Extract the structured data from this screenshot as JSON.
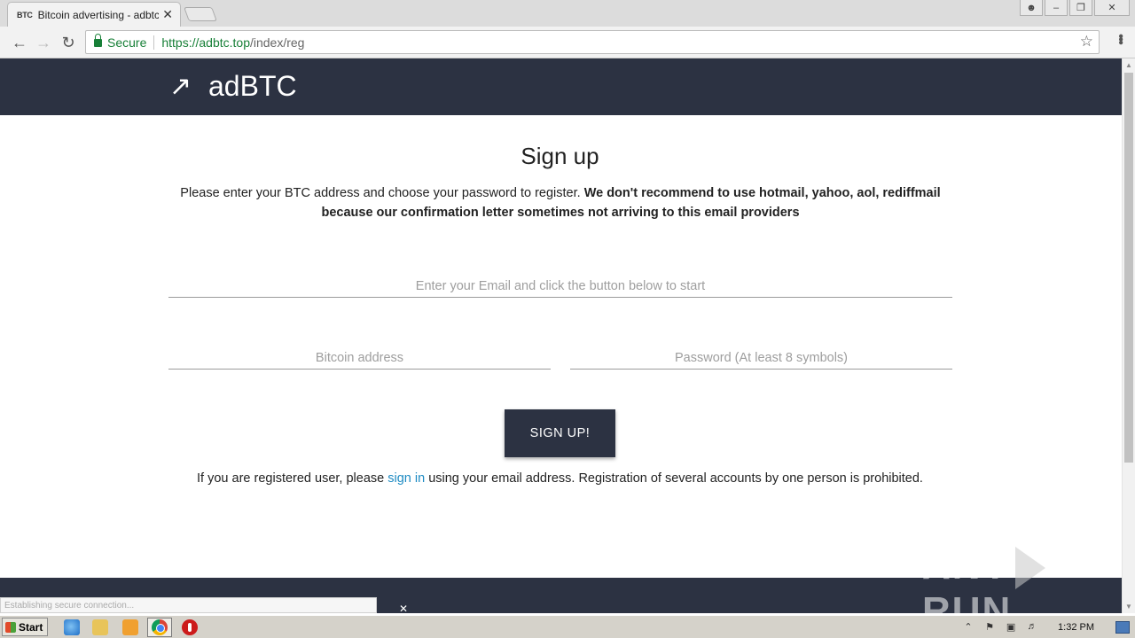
{
  "browser": {
    "tab": {
      "favicon": "BTC",
      "title": "Bitcoin advertising - adbtc.top",
      "close": "✕"
    },
    "window_buttons": [
      "user-icon",
      "minimize-icon",
      "restore-icon",
      "close-icon"
    ],
    "nav": {
      "back": "←",
      "forward": "→",
      "reload": "↻"
    },
    "address": {
      "secure_label": "Secure",
      "url_host": "https://adbtc.top",
      "url_path": "/index/reg"
    }
  },
  "site": {
    "logo_text": "adBTC",
    "heading": "Sign up",
    "intro_plain": "Please enter your BTC address and choose your password to register. ",
    "intro_bold": "We don't recommend to use hotmail, yahoo, aol, rediffmail because our confirmation letter sometimes not arriving to this email providers",
    "email_placeholder": "Enter your Email and click the button below to start",
    "bitcoin_placeholder": "Bitcoin address",
    "password_placeholder": "Password (At least 8 symbols)",
    "signup_button": "SIGN UP!",
    "note_before": "If you are registered user, please ",
    "note_link": "sign in",
    "note_after": " using your email address. Registration of several accounts by one person is prohibited.",
    "colors": {
      "header_bg": "#2c3242",
      "link": "#1e8bc3"
    }
  },
  "status_bar": {
    "text": "Establishing secure connection..."
  },
  "watermark": {
    "left": "ANY",
    "right": "RUN"
  },
  "taskbar": {
    "start_label": "Start",
    "apps": [
      "ie-icon",
      "folder-icon",
      "media-player-icon",
      "chrome-icon",
      "opera-icon"
    ],
    "tray_icons": [
      "arrow-up-icon",
      "flag-icon",
      "network-icon",
      "volume-icon"
    ],
    "clock": "1:32 PM"
  }
}
